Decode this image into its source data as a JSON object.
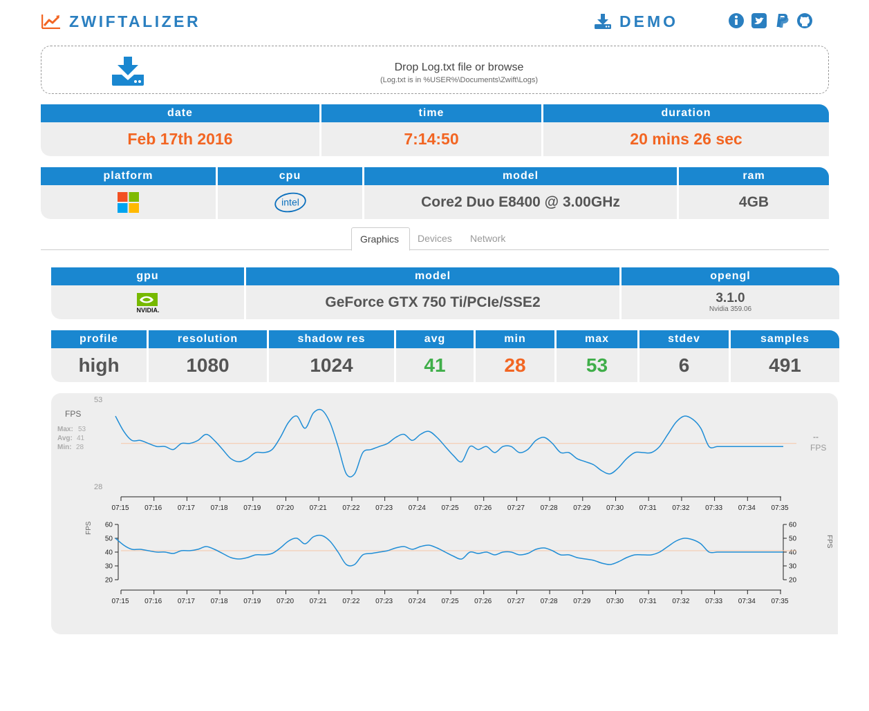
{
  "header": {
    "brand": "ZWIFTALIZER",
    "demo_label": "DEMO",
    "brand_icon": "trend-chart-icon",
    "demo_icon": "download-icon",
    "social_icons": [
      "info-icon",
      "twitter-icon",
      "paypal-icon",
      "github-icon"
    ]
  },
  "dropzone": {
    "title": "Drop Log.txt file or browse",
    "subtitle": "(Log.txt is in %USER%\\Documents\\Zwift\\Logs)",
    "icon": "download-drive-icon"
  },
  "session": {
    "headers": [
      "date",
      "time",
      "duration"
    ],
    "values": [
      "Feb 17th 2016",
      "7:14:50",
      "20 mins 26 sec"
    ]
  },
  "system": {
    "headers": [
      "platform",
      "cpu",
      "model",
      "ram"
    ],
    "platform_icon": "windows-logo",
    "cpu_logo_text": "intel",
    "model": "Core2 Duo E8400 @ 3.00GHz",
    "ram": "4GB"
  },
  "tabs": [
    "Graphics",
    "Devices",
    "Network"
  ],
  "graphics": {
    "headers": [
      "gpu",
      "model",
      "opengl"
    ],
    "gpu_logo_text": "NVIDIA.",
    "model": "GeForce GTX 750 Ti/PCIe/SSE2",
    "opengl_version": "3.1.0",
    "opengl_driver": "Nvidia 359.06"
  },
  "stats": {
    "headers": [
      "profile",
      "resolution",
      "shadow res",
      "avg",
      "min",
      "max",
      "stdev",
      "samples"
    ],
    "values": [
      "high",
      "1080",
      "1024",
      "41",
      "28",
      "53",
      "6",
      "491"
    ]
  },
  "colors": {
    "accent": "#1a87d0",
    "orange": "#f26522",
    "green": "#3fae49",
    "line": "#1f8dd6"
  },
  "fps_panel": {
    "fps_label": "FPS",
    "max_label": "Max:",
    "max_value": "53",
    "avg_label": "Avg:",
    "avg_value": "41",
    "min_label": "Min:",
    "min_value": "28",
    "current_value": "--",
    "current_unit": "FPS"
  },
  "chart_data": [
    {
      "type": "line",
      "title": "",
      "xlabel": "",
      "ylabel": "FPS",
      "ylim": [
        28,
        53
      ],
      "y_ticks": [
        "53",
        "28"
      ],
      "x_ticks": [
        "07:15",
        "07:16",
        "07:17",
        "07:18",
        "07:19",
        "07:20",
        "07:21",
        "07:22",
        "07:23",
        "07:24",
        "07:25",
        "07:26",
        "07:27",
        "07:28",
        "07:29",
        "07:30",
        "07:31",
        "07:32",
        "07:33",
        "07:34",
        "07:35"
      ],
      "avg_line": 41,
      "x": [
        "07:14:50",
        "07:15:05",
        "07:15:20",
        "07:15:35",
        "07:15:50",
        "07:16:05",
        "07:16:20",
        "07:16:35",
        "07:16:50",
        "07:17:05",
        "07:17:20",
        "07:17:35",
        "07:17:50",
        "07:18:05",
        "07:18:20",
        "07:18:35",
        "07:18:50",
        "07:19:05",
        "07:19:20",
        "07:19:35",
        "07:19:50",
        "07:20:05",
        "07:20:20",
        "07:20:35",
        "07:20:50",
        "07:21:05",
        "07:21:20",
        "07:21:35",
        "07:21:50",
        "07:22:05",
        "07:22:20",
        "07:22:35",
        "07:22:50",
        "07:23:05",
        "07:23:20",
        "07:23:35",
        "07:23:50",
        "07:24:05",
        "07:24:20",
        "07:24:35",
        "07:24:50",
        "07:25:05",
        "07:25:20",
        "07:25:35",
        "07:25:50",
        "07:26:05",
        "07:26:20",
        "07:26:35",
        "07:26:50",
        "07:27:05",
        "07:27:20",
        "07:27:35",
        "07:27:50",
        "07:28:05",
        "07:28:20",
        "07:28:35",
        "07:28:50",
        "07:29:05",
        "07:29:20",
        "07:29:35",
        "07:29:50",
        "07:30:05",
        "07:30:20",
        "07:30:35",
        "07:30:50",
        "07:31:05",
        "07:31:20",
        "07:31:35",
        "07:31:50",
        "07:32:05",
        "07:32:20",
        "07:32:35",
        "07:32:50",
        "07:33:05",
        "07:33:20",
        "07:33:35",
        "07:33:50",
        "07:34:05",
        "07:34:20",
        "07:34:35",
        "07:34:50",
        "07:35:05"
      ],
      "series": [
        {
          "values": [
            50,
            45,
            42,
            42,
            41,
            40,
            40,
            39,
            41,
            41,
            42,
            44,
            42,
            39,
            36,
            35,
            36,
            38,
            38,
            39,
            43,
            48,
            50,
            46,
            51,
            52,
            48,
            40,
            31,
            31,
            38,
            39,
            40,
            41,
            43,
            44,
            42,
            44,
            45,
            43,
            40,
            37,
            35,
            40,
            39,
            40,
            38,
            40,
            40,
            38,
            39,
            42,
            43,
            41,
            38,
            38,
            36,
            35,
            34,
            32,
            31,
            33,
            36,
            38,
            38,
            38,
            40,
            44,
            48,
            50,
            49,
            46,
            40,
            40,
            40,
            40,
            40,
            40,
            40,
            40,
            40,
            40
          ]
        }
      ]
    },
    {
      "type": "line",
      "title": "",
      "xlabel": "",
      "ylabel": "FPS",
      "ylim": [
        20,
        60
      ],
      "y_ticks": [
        "20",
        "30",
        "40",
        "50",
        "60"
      ],
      "x_ticks": [
        "07:15",
        "07:16",
        "07:17",
        "07:18",
        "07:19",
        "07:20",
        "07:21",
        "07:22",
        "07:23",
        "07:24",
        "07:25",
        "07:26",
        "07:27",
        "07:28",
        "07:29",
        "07:30",
        "07:31",
        "07:32",
        "07:33",
        "07:34",
        "07:35"
      ],
      "avg_line": 41,
      "note": "overview of same series"
    }
  ]
}
